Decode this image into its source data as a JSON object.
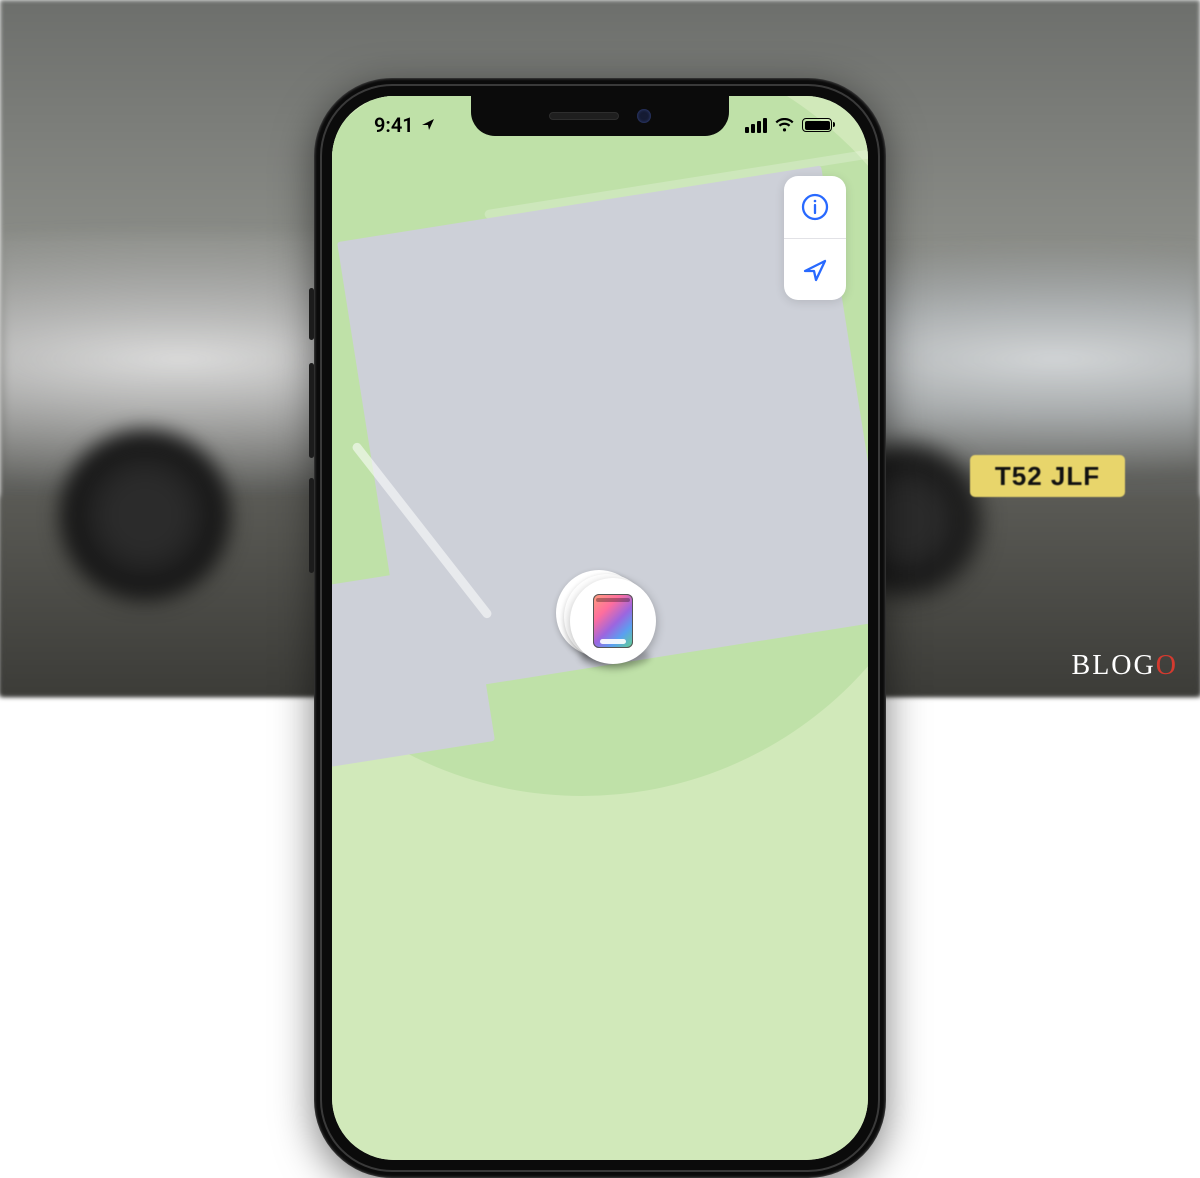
{
  "status_bar": {
    "time": "9:41",
    "location_services_icon": "location-arrow",
    "signal_bars": 4,
    "wifi": true,
    "battery_pct": 100
  },
  "map": {
    "controls": {
      "info_icon": "info-circle",
      "locate_icon": "location-arrow"
    },
    "pin": {
      "device_type": "ipad-icon"
    }
  },
  "background": {
    "license_plate": "T52 JLF"
  },
  "watermark": {
    "part1": "BLOG",
    "accent": "O"
  }
}
